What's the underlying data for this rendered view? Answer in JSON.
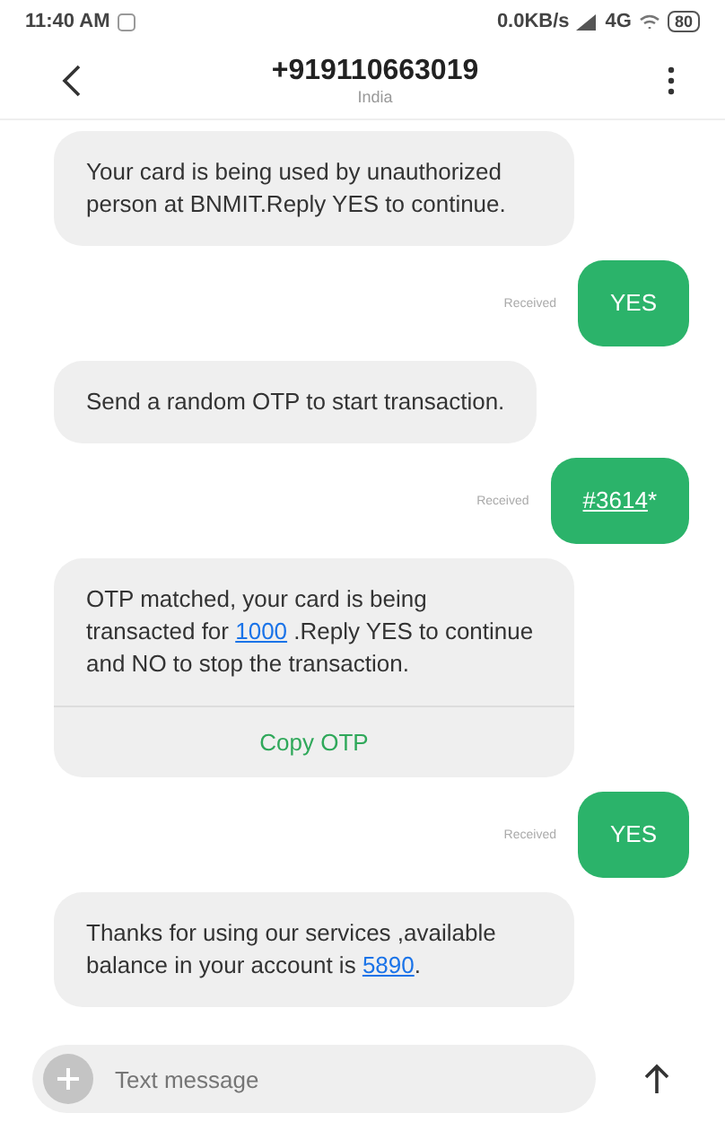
{
  "status_bar": {
    "time": "11:40 AM",
    "network": "0.0KB/s",
    "signal": "4G",
    "battery": "80"
  },
  "header": {
    "title": "+919110663019",
    "subtitle": "India"
  },
  "messages": [
    {
      "kind": "in",
      "parts": [
        {
          "kind": "text",
          "text": "Your card is being used by unauthorized person at BNMIT.Reply YES to continue."
        }
      ]
    },
    {
      "kind": "out",
      "status": "Received",
      "parts": [
        {
          "kind": "text",
          "text": "YES"
        }
      ]
    },
    {
      "kind": "in",
      "parts": [
        {
          "kind": "text",
          "text": "Send a random OTP to start transaction."
        }
      ]
    },
    {
      "kind": "out",
      "status": "Received",
      "parts": [
        {
          "kind": "link",
          "text": "#3614"
        },
        {
          "kind": "text",
          "text": "*"
        }
      ]
    },
    {
      "kind": "in",
      "parts": [
        {
          "kind": "text",
          "text": "OTP matched, your card is being transacted for "
        },
        {
          "kind": "link",
          "text": "1000"
        },
        {
          "kind": "text",
          "text": " .Reply YES to continue and NO to stop the transaction."
        }
      ],
      "action": "Copy OTP"
    },
    {
      "kind": "out",
      "status": "Received",
      "parts": [
        {
          "kind": "text",
          "text": "YES"
        }
      ]
    },
    {
      "kind": "in",
      "parts": [
        {
          "kind": "text",
          "text": "Thanks for using our services ,available balance in your account is  "
        },
        {
          "kind": "link",
          "text": "5890"
        },
        {
          "kind": "text",
          "text": "."
        }
      ]
    }
  ],
  "composer": {
    "placeholder": "Text message"
  }
}
